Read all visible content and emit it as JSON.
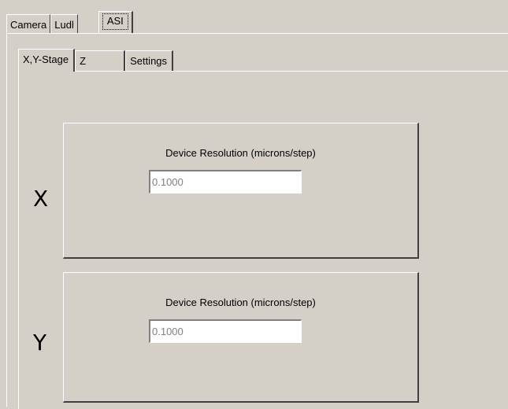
{
  "outer_tabs": [
    {
      "label": "Camera"
    },
    {
      "label": "Ludl"
    },
    {
      "label": "ASI",
      "active": true
    }
  ],
  "inner_tabs": [
    {
      "label": "X,Y-Stage",
      "active": true
    },
    {
      "label": "Z"
    },
    {
      "label": "Settings"
    }
  ],
  "x_axis": {
    "letter": "X",
    "resolution_label": "Device Resolution (microns/step)",
    "resolution_value": "0.1000"
  },
  "y_axis": {
    "letter": "Y",
    "resolution_label": "Device Resolution (microns/step)",
    "resolution_value": "0.1000"
  }
}
